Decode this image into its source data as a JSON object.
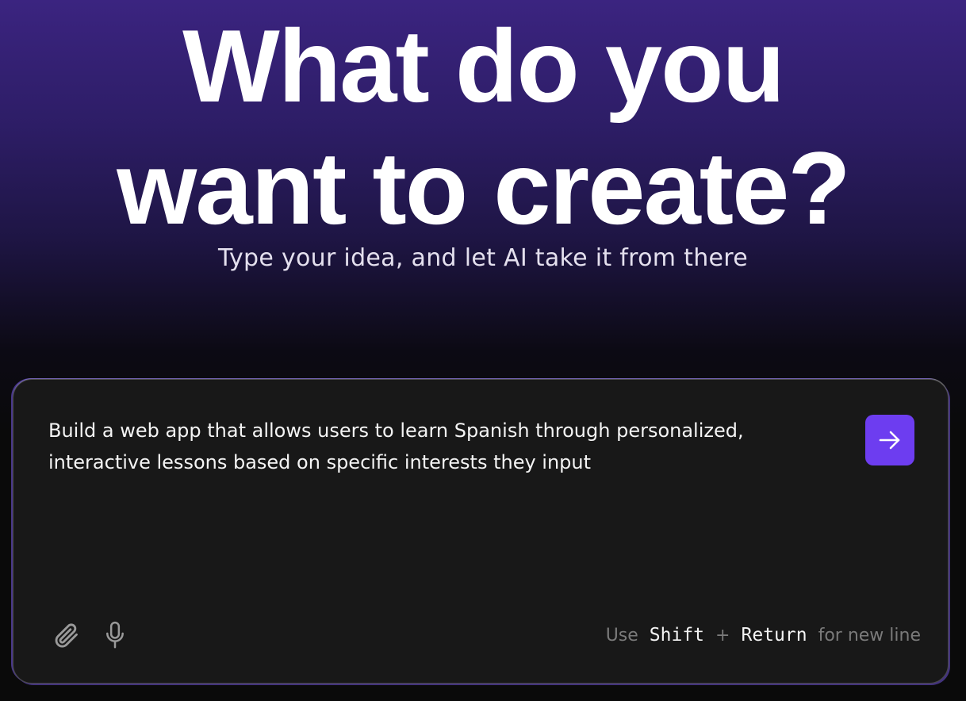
{
  "hero": {
    "headline_line1": "What do you",
    "headline_line2": "want to create?",
    "subtitle": "Type your idea, and let AI take it from there"
  },
  "prompt": {
    "value": "Build a web app that allows users to learn Spanish through personalized, interactive lessons based on specific interests they input"
  },
  "toolbar": {
    "attach_icon": "paperclip-icon",
    "mic_icon": "microphone-icon",
    "send_icon": "arrow-right-icon"
  },
  "hint": {
    "prefix": "Use",
    "key1": "Shift",
    "plus": "+",
    "key2": "Return",
    "suffix": "for new line"
  },
  "colors": {
    "accent": "#6d3df0",
    "box_background": "#181818",
    "gradient_top": "#3b2480"
  }
}
